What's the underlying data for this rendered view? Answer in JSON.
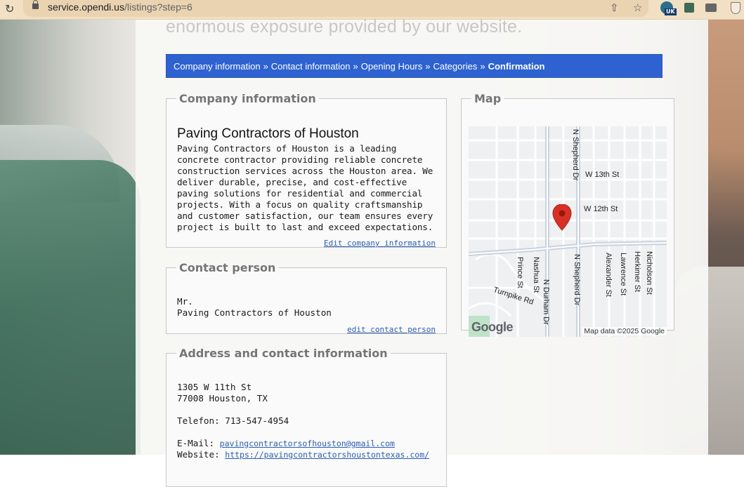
{
  "browser": {
    "url_host": "service.opendi.us",
    "url_path": "/listings?step=6",
    "extension_badge": "UK"
  },
  "hero_text": "enormous exposure provided by our website.",
  "breadcrumb": {
    "items": [
      "Company information",
      "Contact information",
      "Opening Hours",
      "Categories"
    ],
    "separator": "»",
    "current": "Confirmation"
  },
  "company": {
    "legend": "Company information",
    "name": "Paving Contractors of Houston",
    "description": "Paving Contractors of Houston is a leading concrete contractor providing reliable concrete construction services across the Houston area. We deliver durable, precise, and cost-effective paving solutions for residential and commercial projects. With a focus on quality craftsmanship and customer satisfaction, our team ensures every project is built to last and exceed expectations.",
    "edit_link": "Edit company information"
  },
  "contact": {
    "legend": "Contact person",
    "salutation": "Mr.",
    "name": "Paving Contractors of Houston",
    "edit_link": "edit contact person"
  },
  "address": {
    "legend": "Address and contact information",
    "street": "1305 W 11th St",
    "city_line": "77008 Houston, TX",
    "phone_label": "Telefon:",
    "phone": "713-547-4954",
    "email_label": "E-Mail:",
    "email": "pavingcontractorsofhouston@gmail.com",
    "website_label": "Website:",
    "website": "https://pavingcontractorshoustontexas.com/"
  },
  "map": {
    "legend": "Map",
    "streets": {
      "n_shepherd_top": "N Shepherd Dr",
      "w13": "W 13th St",
      "w12": "W 12th St",
      "prince": "Prince St",
      "nashua": "Nashua St",
      "n_durham": "N Durham Dr",
      "n_shepherd_bottom": "N Shepherd Dr",
      "alexander": "Alexander St",
      "lawrence": "Lawrence St",
      "herkimer": "Herkimer St",
      "nicholson": "Nicholson St",
      "turnpike": "Turnpike Rd"
    },
    "logo": "Google",
    "attribution": "Map data ©2025 Google",
    "marker_color": "#d93025"
  },
  "colors": {
    "breadcrumb_bg": "#2e62d0",
    "link": "#2a5db0"
  }
}
